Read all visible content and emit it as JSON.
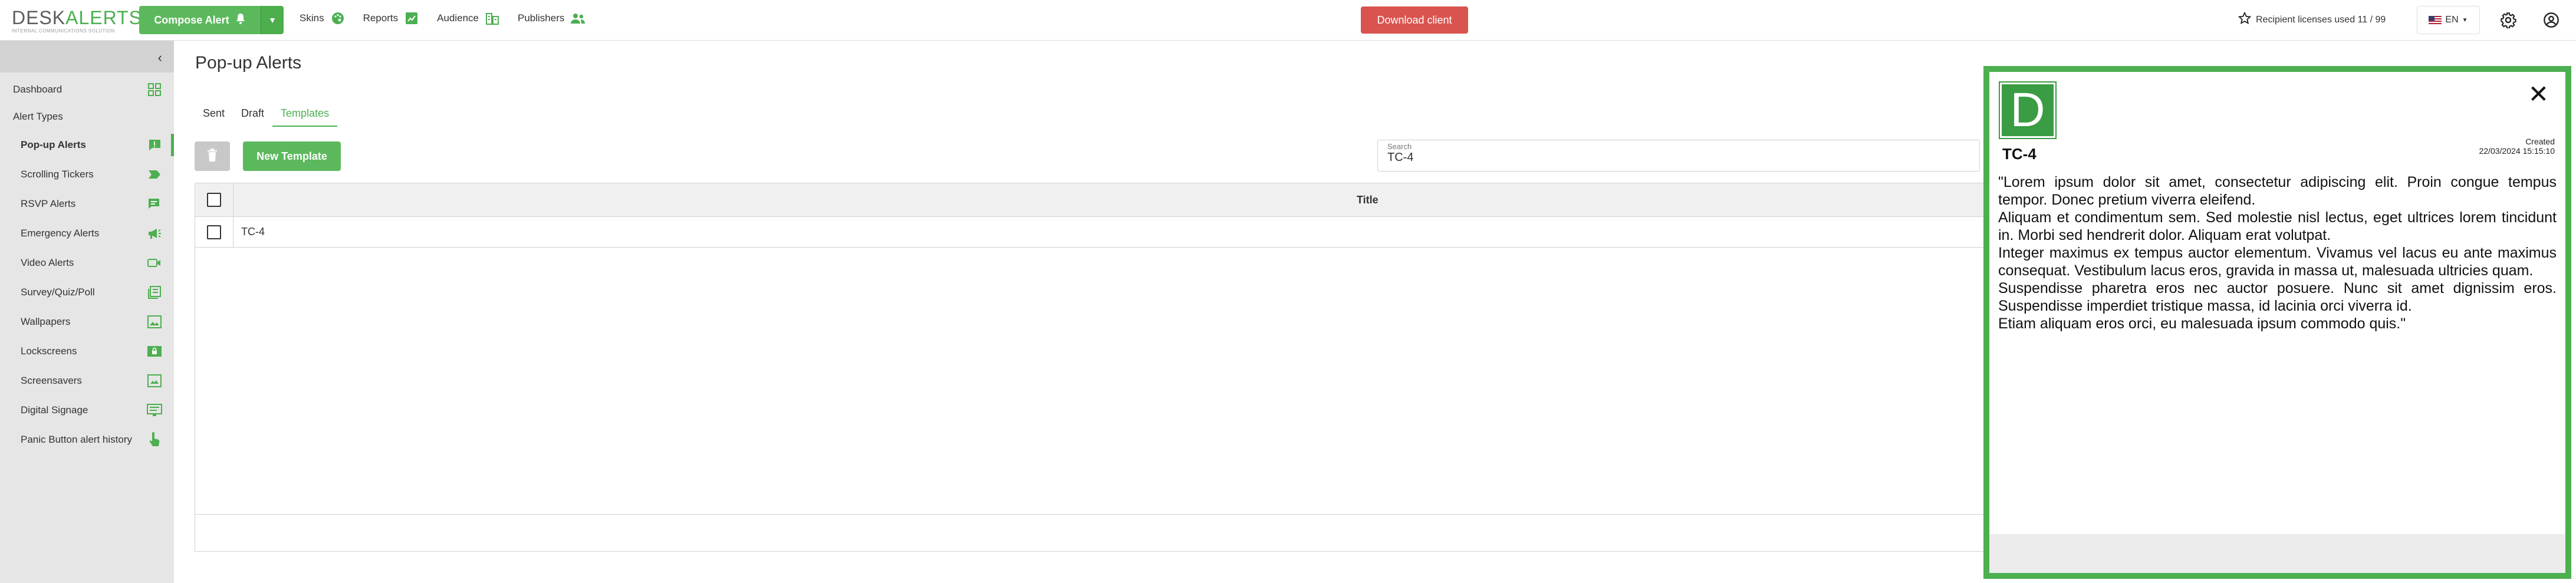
{
  "app": {
    "logo_main_1": "DESK",
    "logo_main_2": "ALERTS",
    "logo_sub": "INTERNAL COMMUNICATIONS SOLUTION"
  },
  "topbar": {
    "compose_label": "Compose Alert",
    "nav": [
      {
        "label": "Skins",
        "icon": "palette-icon"
      },
      {
        "label": "Reports",
        "icon": "chart-icon"
      },
      {
        "label": "Audience",
        "icon": "building-icon"
      },
      {
        "label": "Publishers",
        "icon": "users-icon"
      }
    ],
    "download_label": "Download client",
    "licenses_text": "Recipient licenses used 11 / 99",
    "language": "EN"
  },
  "sidebar": {
    "dashboard": "Dashboard",
    "section": "Alert Types",
    "items": [
      {
        "label": "Pop-up Alerts",
        "icon": "popup-alert-icon"
      },
      {
        "label": "Scrolling Tickers",
        "icon": "ticker-icon"
      },
      {
        "label": "RSVP Alerts",
        "icon": "chat-icon"
      },
      {
        "label": "Emergency Alerts",
        "icon": "megaphone-icon"
      },
      {
        "label": "Video Alerts",
        "icon": "video-icon"
      },
      {
        "label": "Survey/Quiz/Poll",
        "icon": "survey-icon"
      },
      {
        "label": "Wallpapers",
        "icon": "wallpaper-icon"
      },
      {
        "label": "Lockscreens",
        "icon": "lockscreen-icon"
      },
      {
        "label": "Screensavers",
        "icon": "screensaver-icon"
      },
      {
        "label": "Digital Signage",
        "icon": "signage-icon"
      },
      {
        "label": "Panic Button alert history",
        "icon": "hand-pointer-icon"
      }
    ]
  },
  "main": {
    "title": "Pop-up Alerts",
    "tabs": [
      "Sent",
      "Draft",
      "Templates"
    ],
    "active_tab": "Templates",
    "new_template_label": "New Template",
    "search_label": "Search",
    "search_value": "TC-4",
    "table": {
      "header_title": "Title",
      "rows": [
        {
          "title": "TC-4"
        }
      ]
    }
  },
  "preview": {
    "logo_letter": "D",
    "close_symbol": "✕",
    "title": "TC-4",
    "created_label": "Created",
    "created_date": "22/03/2024 15:15:10",
    "body": [
      "\"Lorem ipsum dolor sit amet, consectetur adipiscing elit. Proin congue tempus tempor. Donec pretium viverra eleifend.",
      "Aliquam et condimentum sem. Sed molestie nisl lectus, eget ultrices lorem tincidunt in. Morbi sed hendrerit dolor. Aliquam erat volutpat.",
      "Integer maximus ex tempus auctor elementum. Vivamus vel lacus eu ante maximus consequat. Vestibulum lacus eros, gravida in massa ut, malesuada ultricies quam.",
      "Suspendisse pharetra eros nec auctor posuere. Nunc sit amet dignissim eros. Suspendisse imperdiet tristique massa, id lacinia orci viverra id.",
      "Etiam aliquam eros orci, eu malesuada ipsum commodo quis.\""
    ]
  },
  "colors": {
    "brand_green": "#4caf50",
    "danger_red": "#d9534f",
    "sidebar_bg": "#e6e6e6"
  }
}
